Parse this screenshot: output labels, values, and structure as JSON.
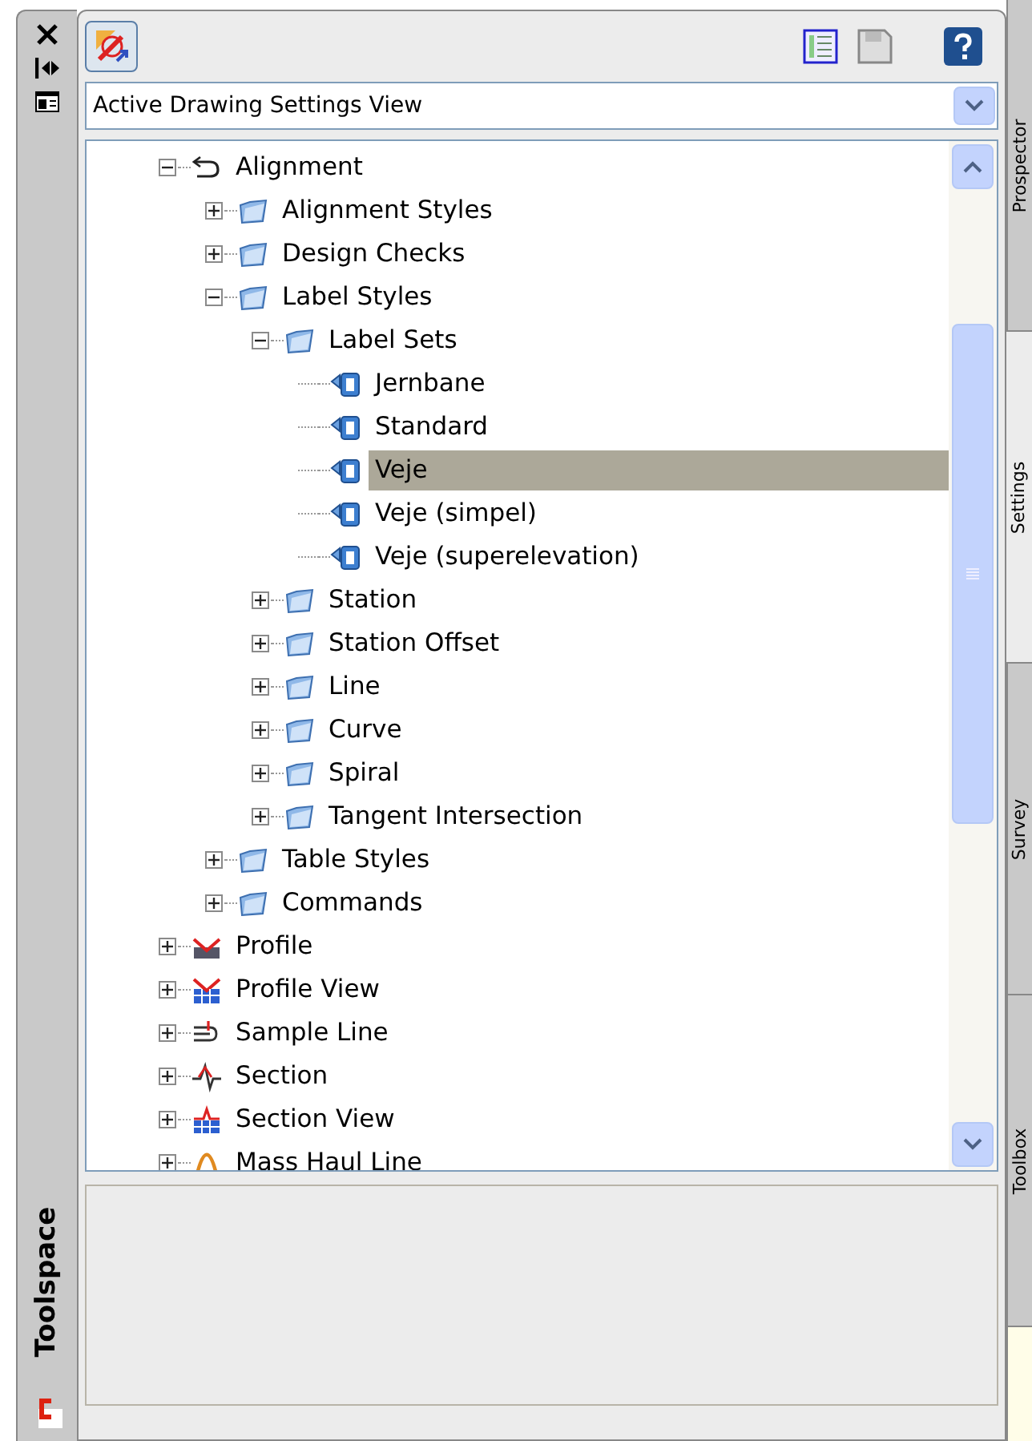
{
  "sidebar": {
    "title": "Toolspace"
  },
  "toolbar": {
    "view_select": {
      "value": "Active Drawing Settings View"
    }
  },
  "tree": [
    {
      "label": "Alignment",
      "kind": "alignment",
      "expanded": true,
      "children": [
        {
          "label": "Alignment Styles",
          "kind": "folder",
          "expanded": false,
          "selected": false
        },
        {
          "label": "Design Checks",
          "kind": "folder",
          "expanded": false,
          "selected": false
        },
        {
          "label": "Label Styles",
          "kind": "folder",
          "expanded": true,
          "selected": false,
          "children": [
            {
              "label": "Label Sets",
              "kind": "folder",
              "expanded": true,
              "selected": false,
              "children": [
                {
                  "label": "Jernbane",
                  "kind": "style",
                  "selected": false
                },
                {
                  "label": "Standard",
                  "kind": "style",
                  "selected": false
                },
                {
                  "label": "Veje",
                  "kind": "style",
                  "selected": true
                },
                {
                  "label": "Veje (simpel)",
                  "kind": "style",
                  "selected": false
                },
                {
                  "label": "Veje (superelevation)",
                  "kind": "style",
                  "selected": false
                }
              ]
            },
            {
              "label": "Station",
              "kind": "folder",
              "expanded": false,
              "selected": false
            },
            {
              "label": "Station Offset",
              "kind": "folder",
              "expanded": false,
              "selected": false
            },
            {
              "label": "Line",
              "kind": "folder",
              "expanded": false,
              "selected": false
            },
            {
              "label": "Curve",
              "kind": "folder",
              "expanded": false,
              "selected": false
            },
            {
              "label": "Spiral",
              "kind": "folder",
              "expanded": false,
              "selected": false
            },
            {
              "label": "Tangent Intersection",
              "kind": "folder",
              "expanded": false,
              "selected": false
            }
          ]
        },
        {
          "label": "Table Styles",
          "kind": "folder",
          "expanded": false,
          "selected": false
        },
        {
          "label": "Commands",
          "kind": "folder",
          "expanded": false,
          "selected": false
        }
      ],
      "selected": false
    },
    {
      "label": "Profile",
      "kind": "profile",
      "expanded": false,
      "selected": false
    },
    {
      "label": "Profile View",
      "kind": "profile-view",
      "expanded": false,
      "selected": false
    },
    {
      "label": "Sample Line",
      "kind": "sample-line",
      "expanded": false,
      "selected": false
    },
    {
      "label": "Section",
      "kind": "section",
      "expanded": false,
      "selected": false
    },
    {
      "label": "Section View",
      "kind": "section-view",
      "expanded": false,
      "selected": false
    },
    {
      "label": "Mass Haul Line",
      "kind": "mass-haul",
      "expanded": false,
      "selected": false
    }
  ],
  "side_tabs": [
    {
      "label": "Prospector",
      "selected": false
    },
    {
      "label": "Settings",
      "selected": true
    },
    {
      "label": "Survey",
      "selected": false
    },
    {
      "label": "Toolbox",
      "selected": false
    }
  ]
}
